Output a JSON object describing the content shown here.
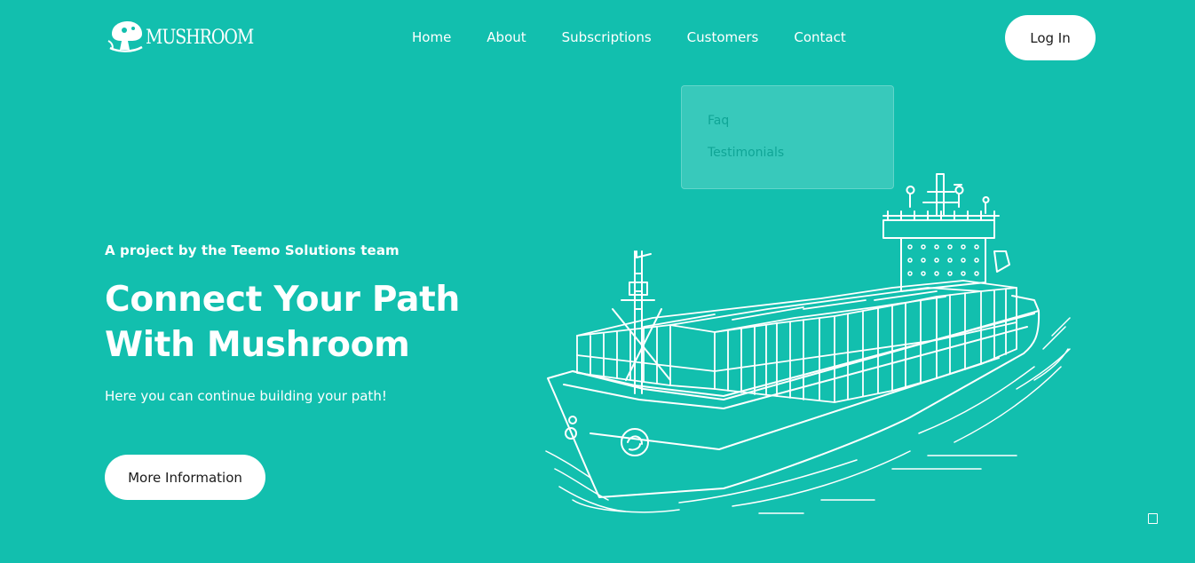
{
  "brand": {
    "name": "MUSHROOM"
  },
  "nav": {
    "items": [
      {
        "label": "Home"
      },
      {
        "label": "About"
      },
      {
        "label": "Subscriptions"
      },
      {
        "label": "Customers"
      },
      {
        "label": "Contact"
      }
    ],
    "login_label": "Log In"
  },
  "dropdown": {
    "items": [
      {
        "label": "Faq"
      },
      {
        "label": "Testimonials"
      }
    ]
  },
  "hero": {
    "tagline": "A project by the Teemo Solutions team",
    "title_line1": "Connect Your Path",
    "title_line2": "With Mushroom",
    "subtitle": "Here you can continue building your path!",
    "button_label": "More Information"
  },
  "colors": {
    "background": "#12bfae",
    "button_bg": "#ffffff",
    "button_text": "#1b1b1b",
    "dropdown_text": "#0fa596"
  },
  "icons": {
    "logo": "mushroom-logo-icon",
    "illustration": "container-ship-illustration",
    "scroll": "scroll-top-icon"
  }
}
